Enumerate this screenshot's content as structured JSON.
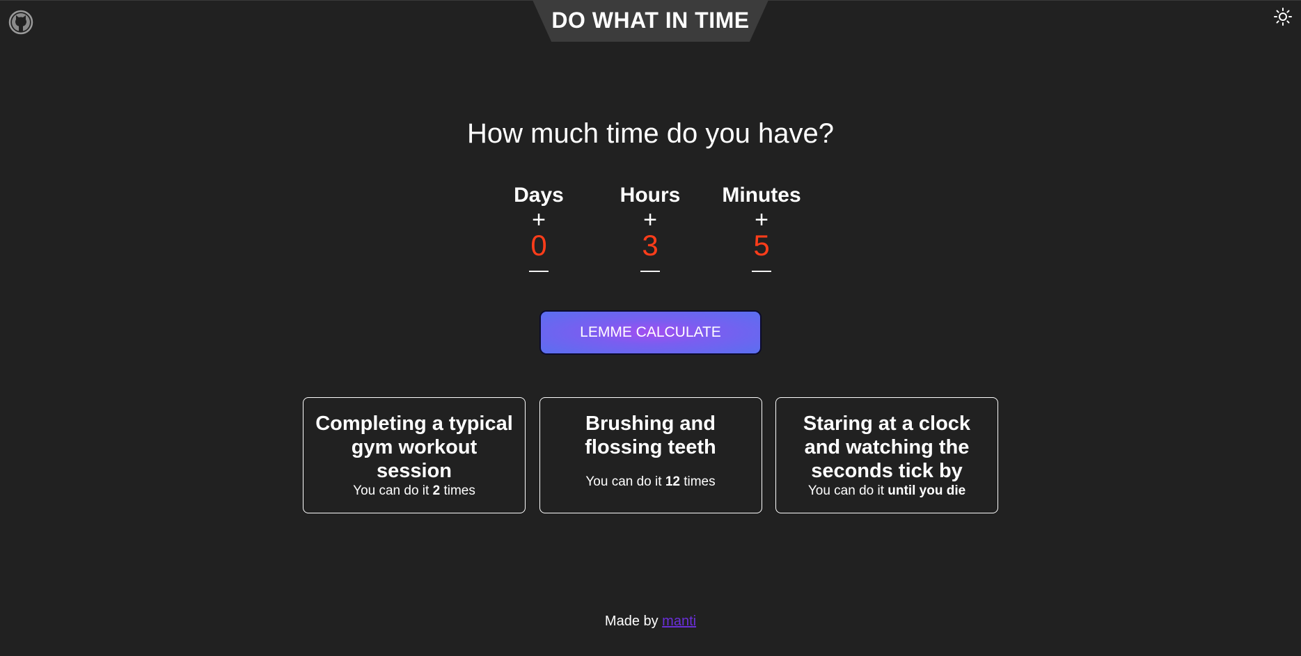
{
  "header": {
    "title": "DO WHAT IN TIME",
    "github_icon": "github-icon",
    "theme_icon": "sun-icon"
  },
  "main": {
    "question": "How much time do you have?",
    "pickers": [
      {
        "label": "Days",
        "value": "0",
        "plus": "+",
        "minus": "—"
      },
      {
        "label": "Hours",
        "value": "3",
        "plus": "+",
        "minus": "—"
      },
      {
        "label": "Minutes",
        "value": "5",
        "plus": "+",
        "minus": "—"
      }
    ],
    "calculate_label": "LEMME CALCULATE"
  },
  "results": [
    {
      "title": "Completing a typical gym workout session",
      "prefix": "You can do it ",
      "count": "2",
      "suffix": " times"
    },
    {
      "title": "Brushing and flossing teeth",
      "prefix": "You can do it ",
      "count": "12",
      "suffix": " times"
    },
    {
      "title": "Staring at a clock and watching the seconds tick by",
      "prefix": "You can do it ",
      "count": "until you die",
      "suffix": ""
    }
  ],
  "footer": {
    "made_by": "Made by ",
    "author": "manti"
  },
  "colors": {
    "background": "#212121",
    "value": "#ff3d1a",
    "banner": "#3c3c3c",
    "link": "#6a2fd8"
  }
}
